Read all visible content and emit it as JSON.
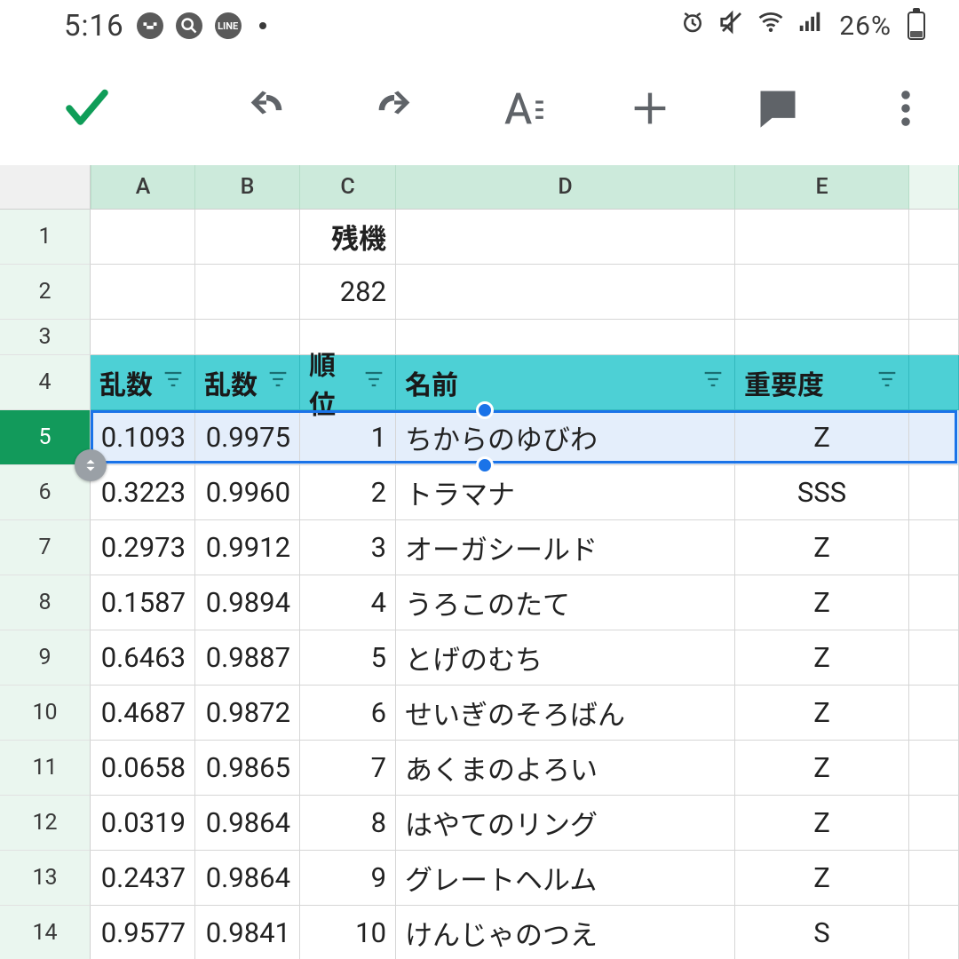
{
  "status": {
    "time": "5:16",
    "battery_pct": "26%",
    "notif_icons": [
      "game-icon",
      "search-icon",
      "line-icon"
    ]
  },
  "columns": [
    "A",
    "B",
    "C",
    "D",
    "E"
  ],
  "row_numbers": [
    1,
    2,
    3,
    4,
    5,
    6,
    7,
    8,
    9,
    10,
    11,
    12,
    13,
    14
  ],
  "meta": {
    "zanki_label": "残機",
    "zanki_value": "282"
  },
  "headers": {
    "A": "乱数",
    "B": "乱数",
    "C": "順位",
    "D": "名前",
    "E": "重要度"
  },
  "rows": [
    {
      "a": "0.1093",
      "b": "0.9975",
      "c": "1",
      "d": "ちからのゆびわ",
      "e": "Z"
    },
    {
      "a": "0.3223",
      "b": "0.9960",
      "c": "2",
      "d": "トラマナ",
      "e": "SSS"
    },
    {
      "a": "0.2973",
      "b": "0.9912",
      "c": "3",
      "d": "オーガシールド",
      "e": "Z"
    },
    {
      "a": "0.1587",
      "b": "0.9894",
      "c": "4",
      "d": "うろこのたて",
      "e": "Z"
    },
    {
      "a": "0.6463",
      "b": "0.9887",
      "c": "5",
      "d": "とげのむち",
      "e": "Z"
    },
    {
      "a": "0.4687",
      "b": "0.9872",
      "c": "6",
      "d": "せいぎのそろばん",
      "e": "Z"
    },
    {
      "a": "0.0658",
      "b": "0.9865",
      "c": "7",
      "d": "あくまのよろい",
      "e": "Z"
    },
    {
      "a": "0.0319",
      "b": "0.9864",
      "c": "8",
      "d": "はやてのリング",
      "e": "Z"
    },
    {
      "a": "0.2437",
      "b": "0.9864",
      "c": "9",
      "d": "グレートヘルム",
      "e": "Z"
    },
    {
      "a": "0.9577",
      "b": "0.9841",
      "c": "10",
      "d": "けんじゃのつえ",
      "e": "S"
    }
  ],
  "selected_row_index": 0,
  "layout": {
    "row_h_default": 62,
    "row_h_3": 40,
    "row_h_4": 62,
    "row_h_data": 62
  }
}
